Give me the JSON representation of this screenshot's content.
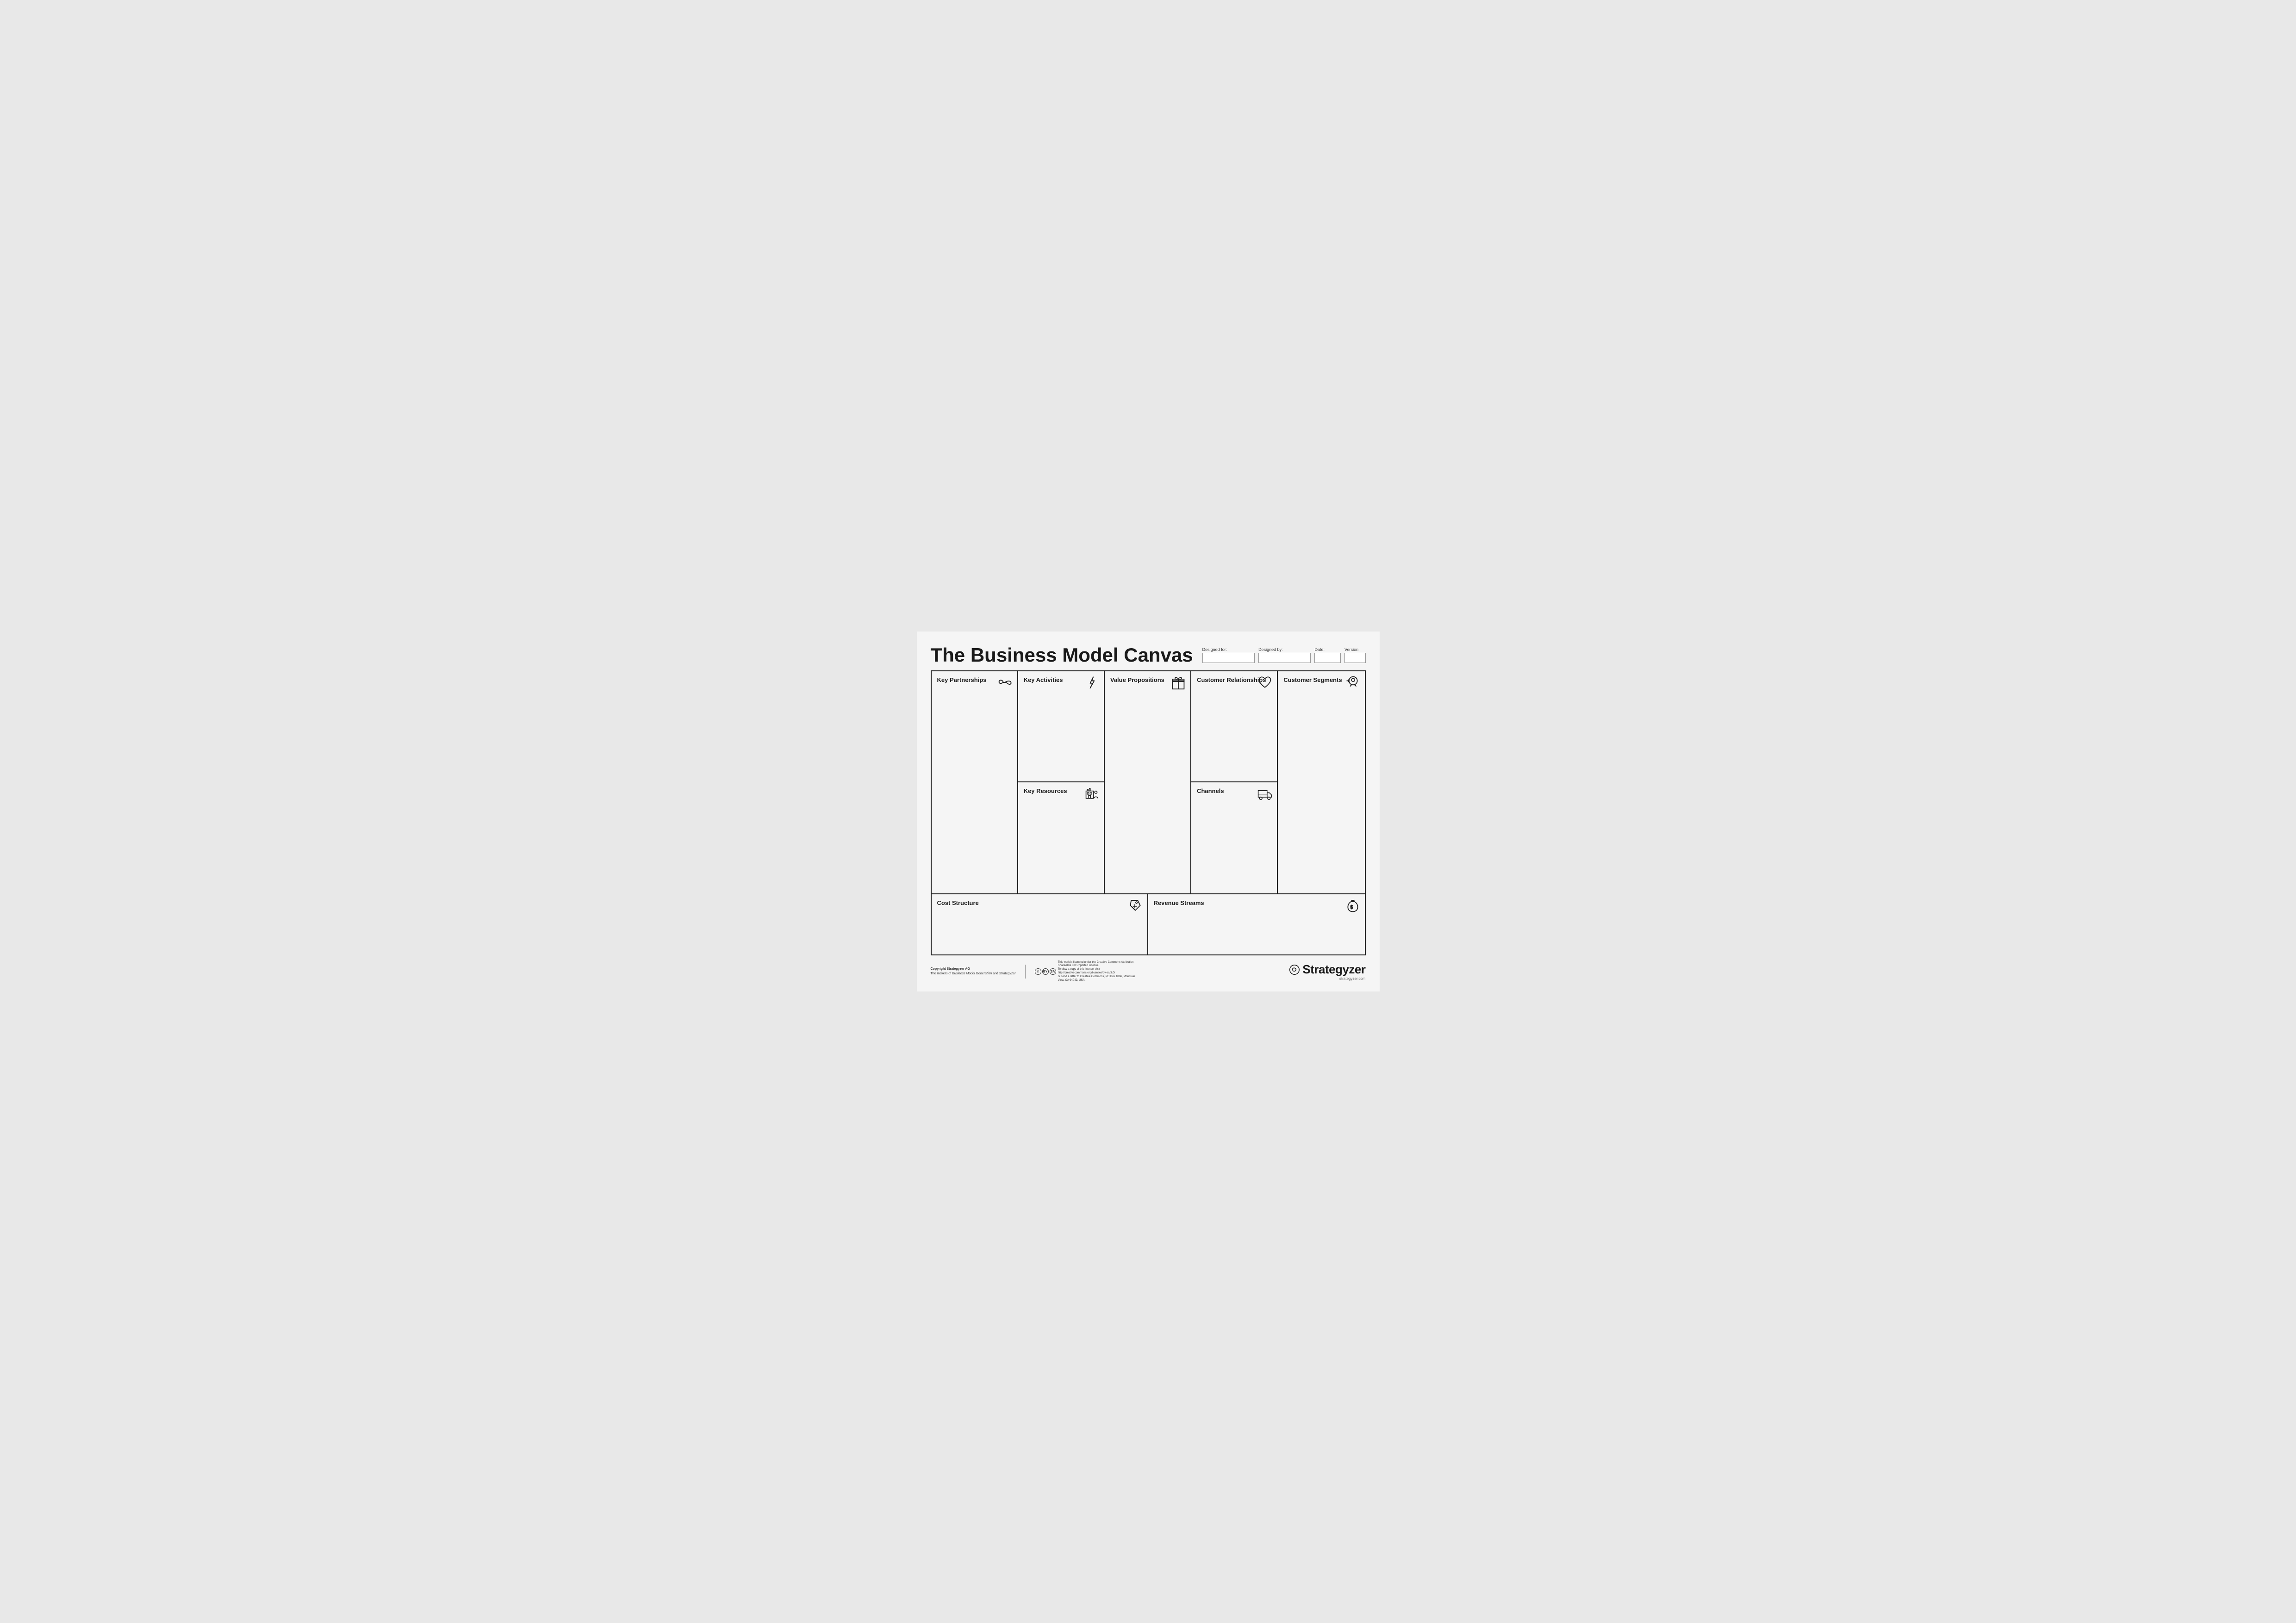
{
  "page": {
    "title": "The Business Model Canvas",
    "header": {
      "designed_for_label": "Designed for:",
      "designed_by_label": "Designed by:",
      "date_label": "Date:",
      "version_label": "Version:",
      "designed_for_value": "",
      "designed_by_value": "",
      "date_value": "",
      "version_value": ""
    },
    "sections": {
      "key_partnerships": "Key Partnerships",
      "key_activities": "Key Activities",
      "key_resources": "Key Resources",
      "value_propositions": "Value Propositions",
      "customer_relationships": "Customer Relationships",
      "channels": "Channels",
      "customer_segments": "Customer Segments",
      "cost_structure": "Cost Structure",
      "revenue_streams": "Revenue Streams"
    },
    "footer": {
      "copyright": "Copyright Strategyzer AG",
      "subtitle_prefix": "The makers of ",
      "book1": "Business Model Generation",
      "subtitle_mid": " and ",
      "book2": "Strategyzer",
      "license_text": "This work is licensed under the Creative Commons Attribution-ShareAlike 3.0 Unported License.\nTo view a copy of this license, visit http://creativecommons.org/licenses/by-sa/3.0/\nor send a letter to Creative Commons, PO Box 1866, Mountain View, CA 94042, USA.",
      "brand": "Strategyzer",
      "url": "strategyzer.com"
    }
  }
}
